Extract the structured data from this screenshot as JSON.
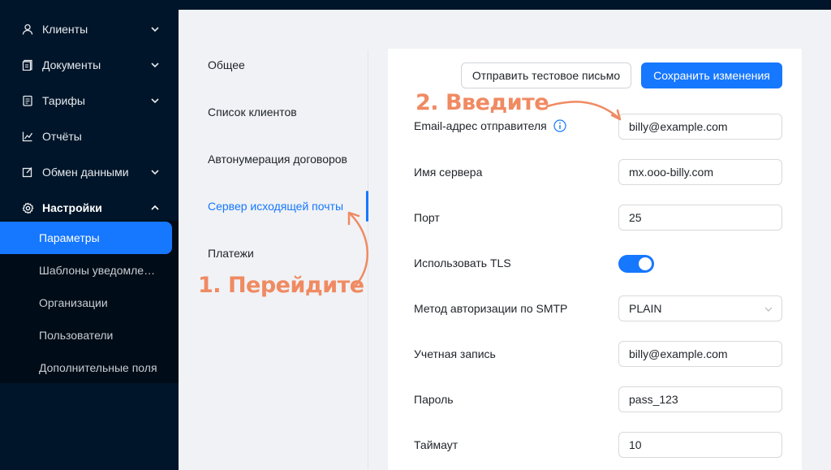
{
  "sidebar": {
    "items": [
      {
        "label": "Клиенты",
        "icon": "user-icon"
      },
      {
        "label": "Документы",
        "icon": "document-icon"
      },
      {
        "label": "Тарифы",
        "icon": "tariff-icon"
      },
      {
        "label": "Отчёты",
        "icon": "chart-icon"
      },
      {
        "label": "Обмен данными",
        "icon": "edit-icon"
      },
      {
        "label": "Настройки",
        "icon": "gear-icon"
      }
    ],
    "submenu": [
      {
        "label": "Параметры",
        "active": true
      },
      {
        "label": "Шаблоны уведомлений"
      },
      {
        "label": "Организации"
      },
      {
        "label": "Пользователи"
      },
      {
        "label": "Дополнительные поля"
      }
    ]
  },
  "tabs": [
    {
      "label": "Общее"
    },
    {
      "label": "Список клиентов"
    },
    {
      "label": "Автонумерация договоров"
    },
    {
      "label": "Сервер исходящей почты",
      "active": true
    },
    {
      "label": "Платежи"
    }
  ],
  "toolbar": {
    "test_email_label": "Отправить тестовое письмо",
    "save_label": "Сохранить изменения"
  },
  "form": {
    "sender_email": {
      "label": "Email-адрес отправителя",
      "value": "billy@example.com"
    },
    "server_name": {
      "label": "Имя сервера",
      "value": "mx.ooo-billy.com"
    },
    "port": {
      "label": "Порт",
      "value": "25"
    },
    "use_tls": {
      "label": "Использовать TLS",
      "enabled": true
    },
    "smtp_auth": {
      "label": "Метод авторизации по SMTP",
      "value": "PLAIN"
    },
    "account": {
      "label": "Учетная запись",
      "value": "billy@example.com"
    },
    "password": {
      "label": "Пароль",
      "value": "pass_123"
    },
    "timeout": {
      "label": "Таймаут",
      "value": "10"
    }
  },
  "annotations": {
    "step1": "1. Перейдите",
    "step2": "2. Введите"
  },
  "colors": {
    "sidebar_bg": "#001529",
    "accent": "#1677ff",
    "annotation": "#f08a62"
  }
}
